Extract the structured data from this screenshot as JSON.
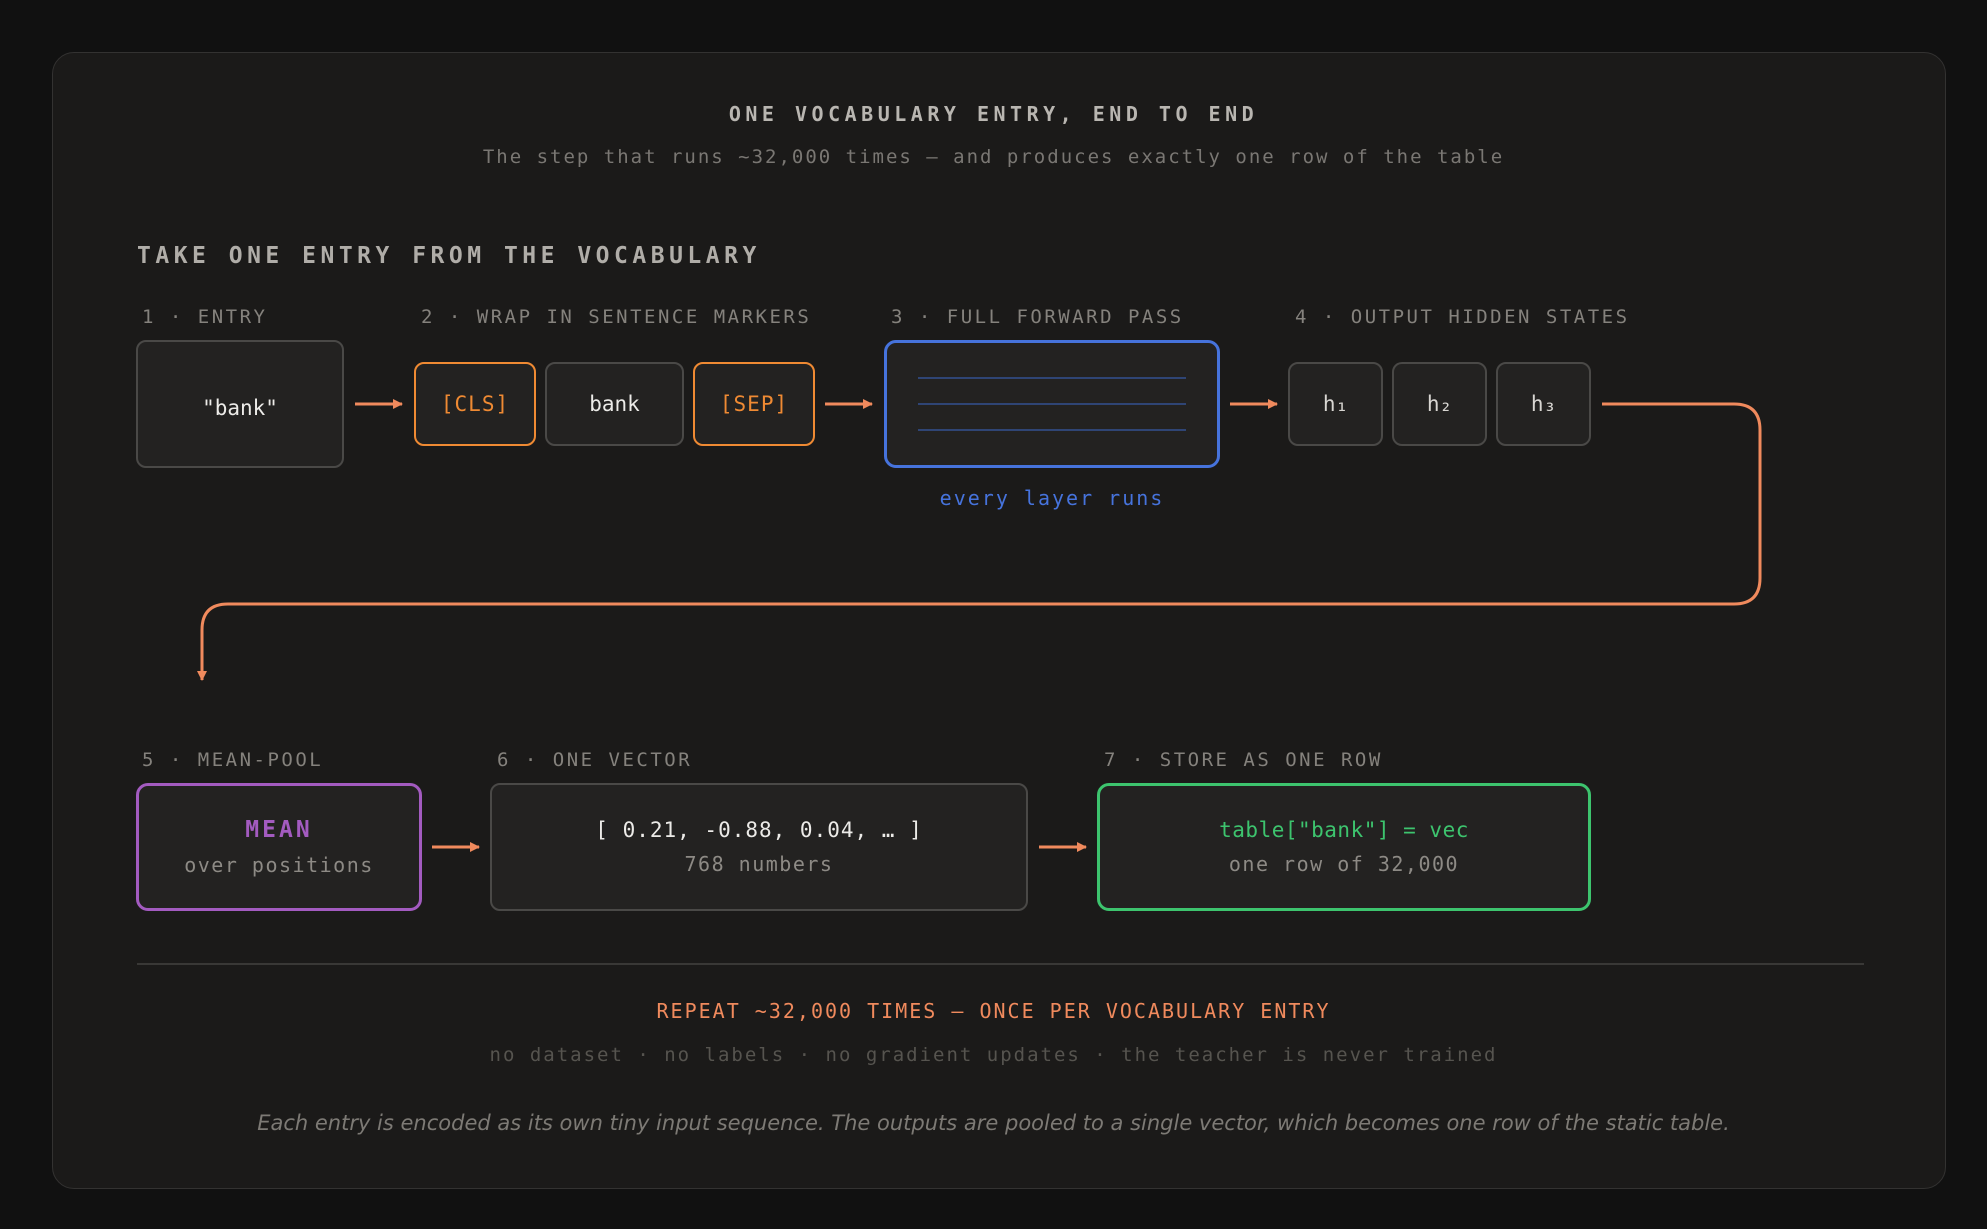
{
  "header": {
    "title": "ONE VOCABULARY ENTRY, END TO END",
    "subtitle": "The step that runs ~32,000 times — and produces exactly one row of the table"
  },
  "section_title": "TAKE ONE ENTRY FROM THE VOCABULARY",
  "steps": {
    "s1": {
      "label": "1 · ENTRY",
      "text": "\"bank\""
    },
    "s2": {
      "label": "2 · WRAP IN SENTENCE MARKERS",
      "tokens": [
        "[CLS]",
        "bank",
        "[SEP]"
      ]
    },
    "s3": {
      "label": "3 · FULL FORWARD PASS",
      "caption": "every layer runs"
    },
    "s4": {
      "label": "4 · OUTPUT HIDDEN STATES",
      "states": [
        "h₁",
        "h₂",
        "h₃"
      ]
    },
    "s5": {
      "label": "5 · MEAN-POOL",
      "main": "MEAN",
      "sub": "over positions"
    },
    "s6": {
      "label": "6 · ONE VECTOR",
      "main": "[ 0.21, -0.88, 0.04, … ]",
      "sub": "768 numbers"
    },
    "s7": {
      "label": "7 · STORE AS ONE ROW",
      "main": "table[\"bank\"] = vec",
      "sub": "one row of 32,000"
    }
  },
  "footer": {
    "repeat": "REPEAT ~32,000 TIMES — ONCE PER VOCABULARY ENTRY",
    "notes": "no dataset · no labels · no gradient updates · the teacher is never trained",
    "caption": "Each entry is encoded as its own tiny input sequence. The outputs are pooled to a single vector, which becomes one row of the static table."
  },
  "colors": {
    "background": "#111111",
    "card": "#1b1a19",
    "orange": "#ef8a33",
    "arrow": "#f08a5d",
    "blue": "#4673dc",
    "purple": "#a35bc0",
    "green": "#3dc46e"
  }
}
